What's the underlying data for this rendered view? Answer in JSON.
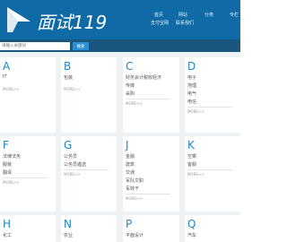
{
  "header": {
    "logo_text": "面试119",
    "nav": [
      "首页",
      "网站",
      "分类",
      "专栏",
      "支付宝网",
      "联系我们"
    ]
  },
  "search": {
    "placeholder": "请输入关键词",
    "button_label": "搜索"
  },
  "cards": [
    {
      "letter": "A",
      "items": [
        "IT"
      ],
      "more": "MORE>>"
    },
    {
      "letter": "B",
      "items": [
        "包装"
      ],
      "more": "MORE>>"
    },
    {
      "letter": "C",
      "items": [
        "财务会计税收经济",
        "传媒",
        "采购"
      ],
      "more": "MORE>>"
    },
    {
      "letter": "D",
      "items": [
        "电子",
        "地理",
        "电气",
        "电信"
      ],
      "more": "MORE>>"
    },
    {
      "letter": "F",
      "items": [
        "法律法务",
        "服装",
        "翻译"
      ],
      "more": "MORE>>"
    },
    {
      "letter": "G",
      "items": [
        "公务员",
        "公务员遴选"
      ],
      "more": "MORE>>"
    },
    {
      "letter": "J",
      "items": [
        "金融",
        "建筑",
        "交通",
        "军队文职",
        "军转干"
      ],
      "more": "MORE>>"
    },
    {
      "letter": "K",
      "items": [
        "空乘",
        "客服"
      ],
      "more": "MORE>>"
    },
    {
      "letter": "H",
      "items": [
        "化工"
      ],
      "more": ""
    },
    {
      "letter": "N",
      "items": [
        "农业"
      ],
      "more": ""
    },
    {
      "letter": "P",
      "items": [
        "平面设计"
      ],
      "more": ""
    },
    {
      "letter": "Q",
      "items": [
        "汽车"
      ],
      "more": ""
    }
  ]
}
